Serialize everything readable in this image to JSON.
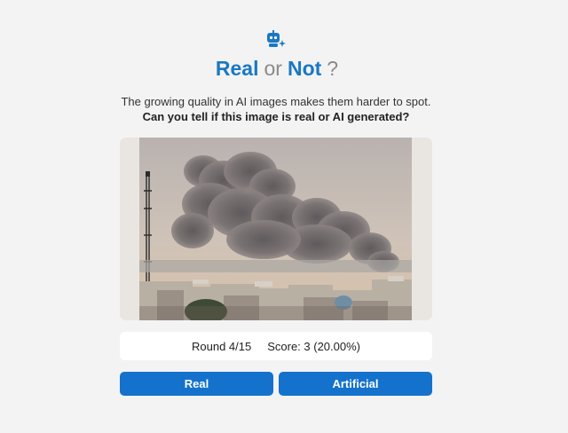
{
  "app": {
    "logo_icon": "robot-sparkle-icon",
    "title_parts": {
      "real": "Real",
      "or": "or",
      "not": "Not",
      "question_mark": "?"
    },
    "description": "The growing quality in AI images makes them harder to spot.",
    "question": "Can you tell if this image is real or AI generated?"
  },
  "image": {
    "subject": "smoke-cloud-over-city"
  },
  "status": {
    "round_label": "Round 4/15",
    "score_label": "Score: 3 (20.00%)"
  },
  "buttons": {
    "real_label": "Real",
    "artificial_label": "Artificial"
  },
  "colors": {
    "accent": "#1a78c2",
    "button": "#1472cc",
    "background": "#f3f3f3"
  }
}
